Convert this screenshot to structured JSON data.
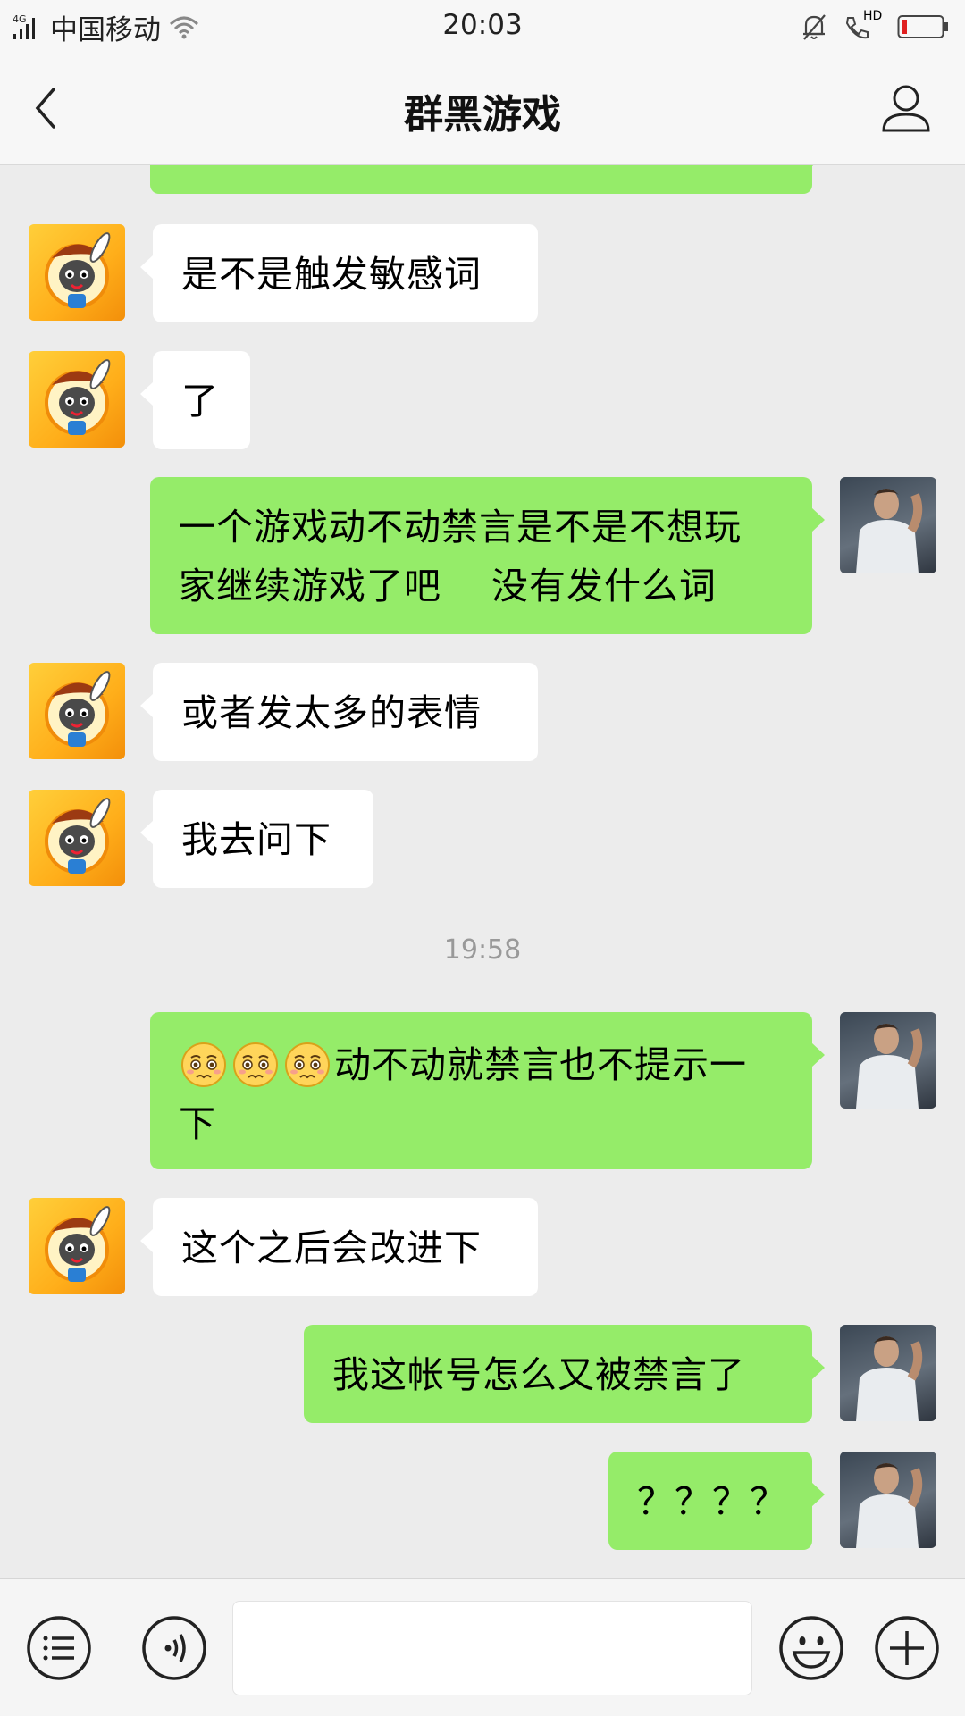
{
  "status_bar": {
    "network": "4G",
    "carrier": "中国移动",
    "time": "20:03",
    "hd_label": "HD",
    "battery_color": "#e02020"
  },
  "header": {
    "title": "群黑游戏"
  },
  "messages": [
    {
      "side": "in",
      "text": "是不是触发敏感词"
    },
    {
      "side": "in",
      "text": "了"
    },
    {
      "side": "out",
      "line1": "一个游戏动不动禁言是不是不想玩",
      "line2": "家继续游戏了吧　 没有发什么词"
    },
    {
      "side": "in",
      "text": "或者发太多的表情"
    },
    {
      "side": "in",
      "text": "我去问下"
    },
    {
      "side": "out",
      "line1": "动不动就禁言也不提示一",
      "line2": "下",
      "emoji": "worried-face-icon"
    },
    {
      "side": "in",
      "text": "这个之后会改进下"
    },
    {
      "side": "out",
      "text": "我这帐号怎么又被禁言了"
    },
    {
      "side": "out",
      "text": "？？？？"
    }
  ],
  "timestamp": "19:58",
  "input": {
    "placeholder": ""
  },
  "colors": {
    "out_bubble": "#95ec69",
    "in_bubble": "#ffffff",
    "background": "#ececec"
  }
}
